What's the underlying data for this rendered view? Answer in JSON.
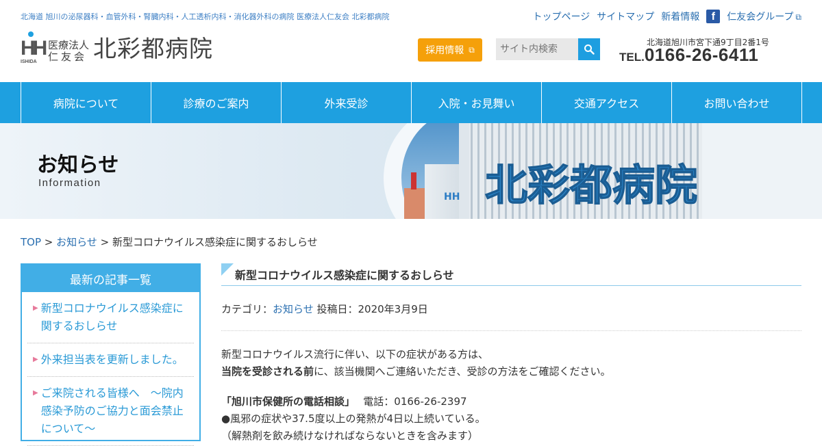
{
  "header": {
    "tagline": "北海道 旭川の泌尿器科・血管外科・腎臓内科・人工透析内科・消化器外科の病院 医療法人仁友会 北彩都病院",
    "logo": {
      "mark_letters": "HH",
      "mark_sub": "ISHIDA",
      "corp_line1": "医療法人",
      "corp_line2": "仁友会",
      "hospital_name": "北彩都病院"
    },
    "top_links": [
      "トップページ",
      "サイトマップ",
      "新着情報"
    ],
    "group_link": "仁友会グループ",
    "recruit_label": "採用情報",
    "search_placeholder": "サイト内検索",
    "address": "北海道旭川市宮下通9丁目2番1号",
    "tel_label": "TEL.",
    "tel_number": "0166-26-6411"
  },
  "nav": {
    "items": [
      "病院について",
      "診療のご案内",
      "外来受診",
      "入院・お見舞い",
      "交通アクセス",
      "お問い合わせ"
    ]
  },
  "banner": {
    "title": "お知らせ",
    "subtitle": "Information",
    "sign_text": "北彩都病院"
  },
  "breadcrumb": {
    "top": "TOP",
    "sep": ">",
    "section": "お知らせ",
    "current": "新型コロナウイルス感染症に関するおしらせ"
  },
  "sidebar": {
    "heading": "最新の記事一覧",
    "items": [
      "新型コロナウイルス感染症に関するおしらせ",
      "外来担当表を更新しました。",
      "ご来院される皆様へ　～院内感染予防のご協力と面会禁止について～"
    ]
  },
  "article": {
    "title": "新型コロナウイルス感染症に関するおしらせ",
    "category_label": "カテゴリ：",
    "category": "お知らせ",
    "posted": "投稿日：2020年3月9日",
    "intro": "新型コロナウイルス流行に伴い、以下の症状がある方は、",
    "line2_bold": "当院を受診される前",
    "line2_rest": "に、該当機関へご連絡いただき、受診の方法をご確認ください。",
    "contact_name": "「旭川市保健所の電話相談」",
    "contact_phone": "電話：0166-26-2397",
    "symptom1": "●風邪の症状や37.5度以上の発熱が4日以上続いている。",
    "symptom1_note": "（解熱剤を飲み続けなければならないときを含みます）"
  },
  "colors": {
    "nav_blue": "#1ea0e0",
    "recruit_orange": "#f5a00a",
    "link_blue": "#2a6fb0",
    "sidebar_blue": "#41aee6"
  }
}
